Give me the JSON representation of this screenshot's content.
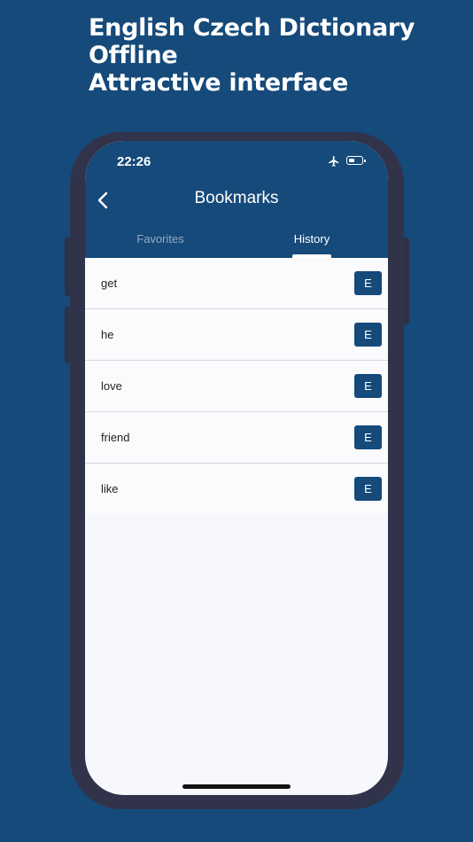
{
  "headline": {
    "line1": "English Czech Dictionary",
    "line2": "Offline",
    "line3": "Attractive interface"
  },
  "status_bar": {
    "time": "22:26",
    "icons": [
      "airplane-icon",
      "battery-icon"
    ]
  },
  "nav": {
    "back_icon": "chevron-left-icon",
    "title": "Bookmarks"
  },
  "tabs": [
    {
      "label": "Favorites",
      "selected": false
    },
    {
      "label": "History",
      "selected": true
    }
  ],
  "history": [
    {
      "word": "get",
      "badge": "E"
    },
    {
      "word": "he",
      "badge": "E"
    },
    {
      "word": "love",
      "badge": "E"
    },
    {
      "word": "friend",
      "badge": "E"
    },
    {
      "word": "like",
      "badge": "E"
    }
  ],
  "colors": {
    "brand": "#154a7a",
    "phone_frame": "#31334a",
    "screen_bg": "#f7f8fd"
  }
}
